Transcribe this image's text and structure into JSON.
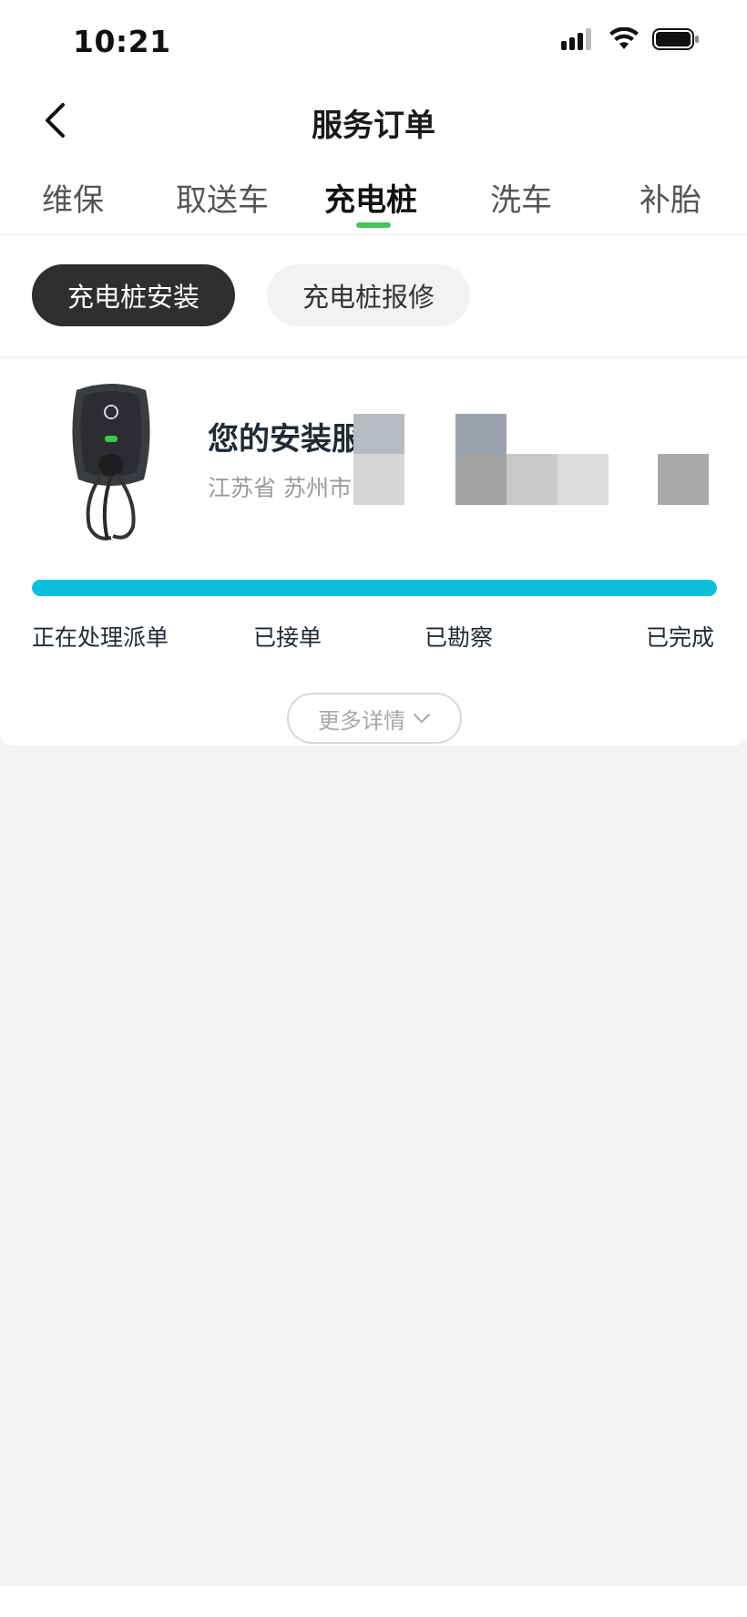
{
  "status_bar": {
    "time": "10:21",
    "icons": [
      "cellular-signal-icon",
      "wifi-icon",
      "battery-icon"
    ]
  },
  "nav": {
    "back_icon": "chevron-left-icon",
    "title": "服务订单"
  },
  "tabs": [
    {
      "label": "维保",
      "active": false
    },
    {
      "label": "取送车",
      "active": false
    },
    {
      "label": "充电桩",
      "active": true
    },
    {
      "label": "洗车",
      "active": false
    },
    {
      "label": "补胎",
      "active": false
    }
  ],
  "sub_tabs": [
    {
      "label": "充电桩安装",
      "active": true
    },
    {
      "label": "充电桩报修",
      "active": false
    }
  ],
  "order": {
    "image": "ev-charger-image",
    "title": "您的安装服务已完成",
    "address": "江苏省 苏州市",
    "progress_percent": 100,
    "steps": [
      "正在处理派单",
      "已接单",
      "已勘察",
      "已完成"
    ],
    "more_button": "更多详情",
    "more_icon": "chevron-down-icon"
  },
  "colors": {
    "accent_green": "#45c45a",
    "progress_cyan": "#0bc0dc",
    "chip_dark": "#2f2f2f",
    "page_background": "#f3f3f3"
  }
}
